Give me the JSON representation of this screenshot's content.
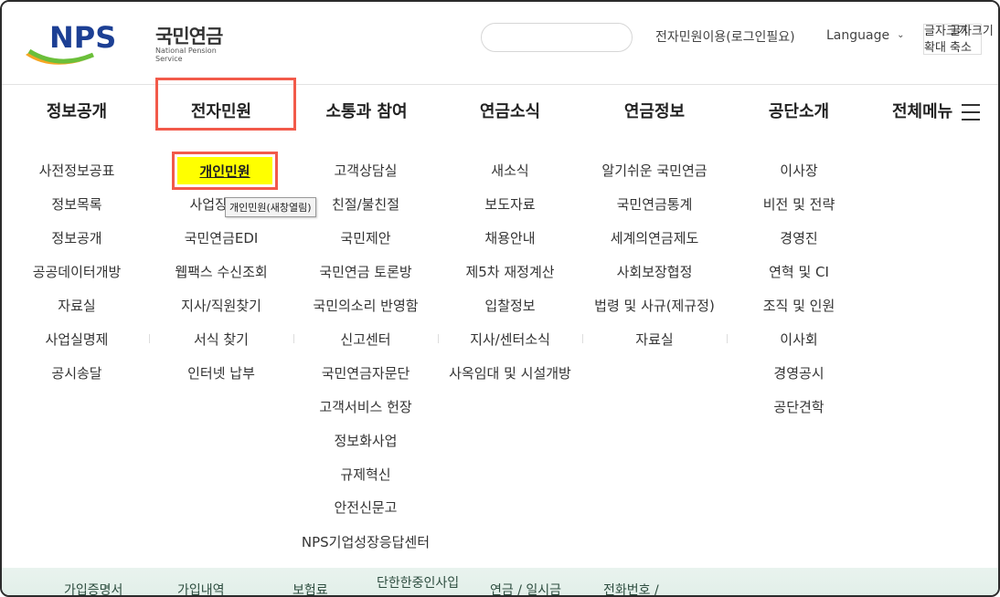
{
  "header": {
    "logo": {
      "brand": "NPS",
      "name": "국민연금",
      "sub": "National Pension Service"
    },
    "search_placeholder": "",
    "login_link": "전자민원이용(로그인필요)",
    "language": "Language",
    "fontsize": {
      "line1a": "글자크기",
      "line1b": "글자크기",
      "line2": "확대 축소"
    }
  },
  "gnb": {
    "items": [
      "정보공개",
      "전자민원",
      "소통과 참여",
      "연금소식",
      "연금정보",
      "공단소개"
    ],
    "all_menu": "전체메뉴"
  },
  "mega": {
    "columns": [
      [
        "사전정보공표",
        "정보목록",
        "정보공개",
        "공공데이터개방",
        "자료실",
        "사업실명제",
        "공시송달"
      ],
      [
        "개인민원",
        "사업장민원",
        "국민연금EDI",
        "웹팩스 수신조회",
        "지사/직원찾기",
        "서식 찾기",
        "인터넷 납부"
      ],
      [
        "고객상담실",
        "친절/불친절",
        "국민제안",
        "국민연금 토론방",
        "국민의소리 반영함",
        "신고센터",
        "국민연금자문단",
        "고객서비스 헌장",
        "정보화사업",
        "규제혁신",
        "안전신문고",
        "NPS기업성장응답센터"
      ],
      [
        "새소식",
        "보도자료",
        "채용안내",
        "제5차 재정계산",
        "입찰정보",
        "지사/센터소식",
        "사옥임대 및 시설개방"
      ],
      [
        "알기쉬운 국민연금",
        "국민연금통계",
        "세계의연금제도",
        "사회보장협정",
        "법령 및 사규(제규정)",
        "자료실"
      ],
      [
        "이사장",
        "비전 및 전략",
        "경영진",
        "연혁 및 CI",
        "조직 및 인원",
        "이사회",
        "경영공시",
        "공단견학"
      ]
    ],
    "tooltip": "개인민원(새창열림)"
  },
  "bottom": {
    "items": [
      "가입증명서",
      "가입내역",
      "보험료",
      "단한한중인사입",
      "연금 / 일시금",
      "전화번호 /"
    ]
  },
  "colors": {
    "highlight_border": "#f25a4a",
    "highlight_fill": "#ffff00",
    "brand_blue": "#1c3f94",
    "brand_green": "#6bbf3a"
  }
}
